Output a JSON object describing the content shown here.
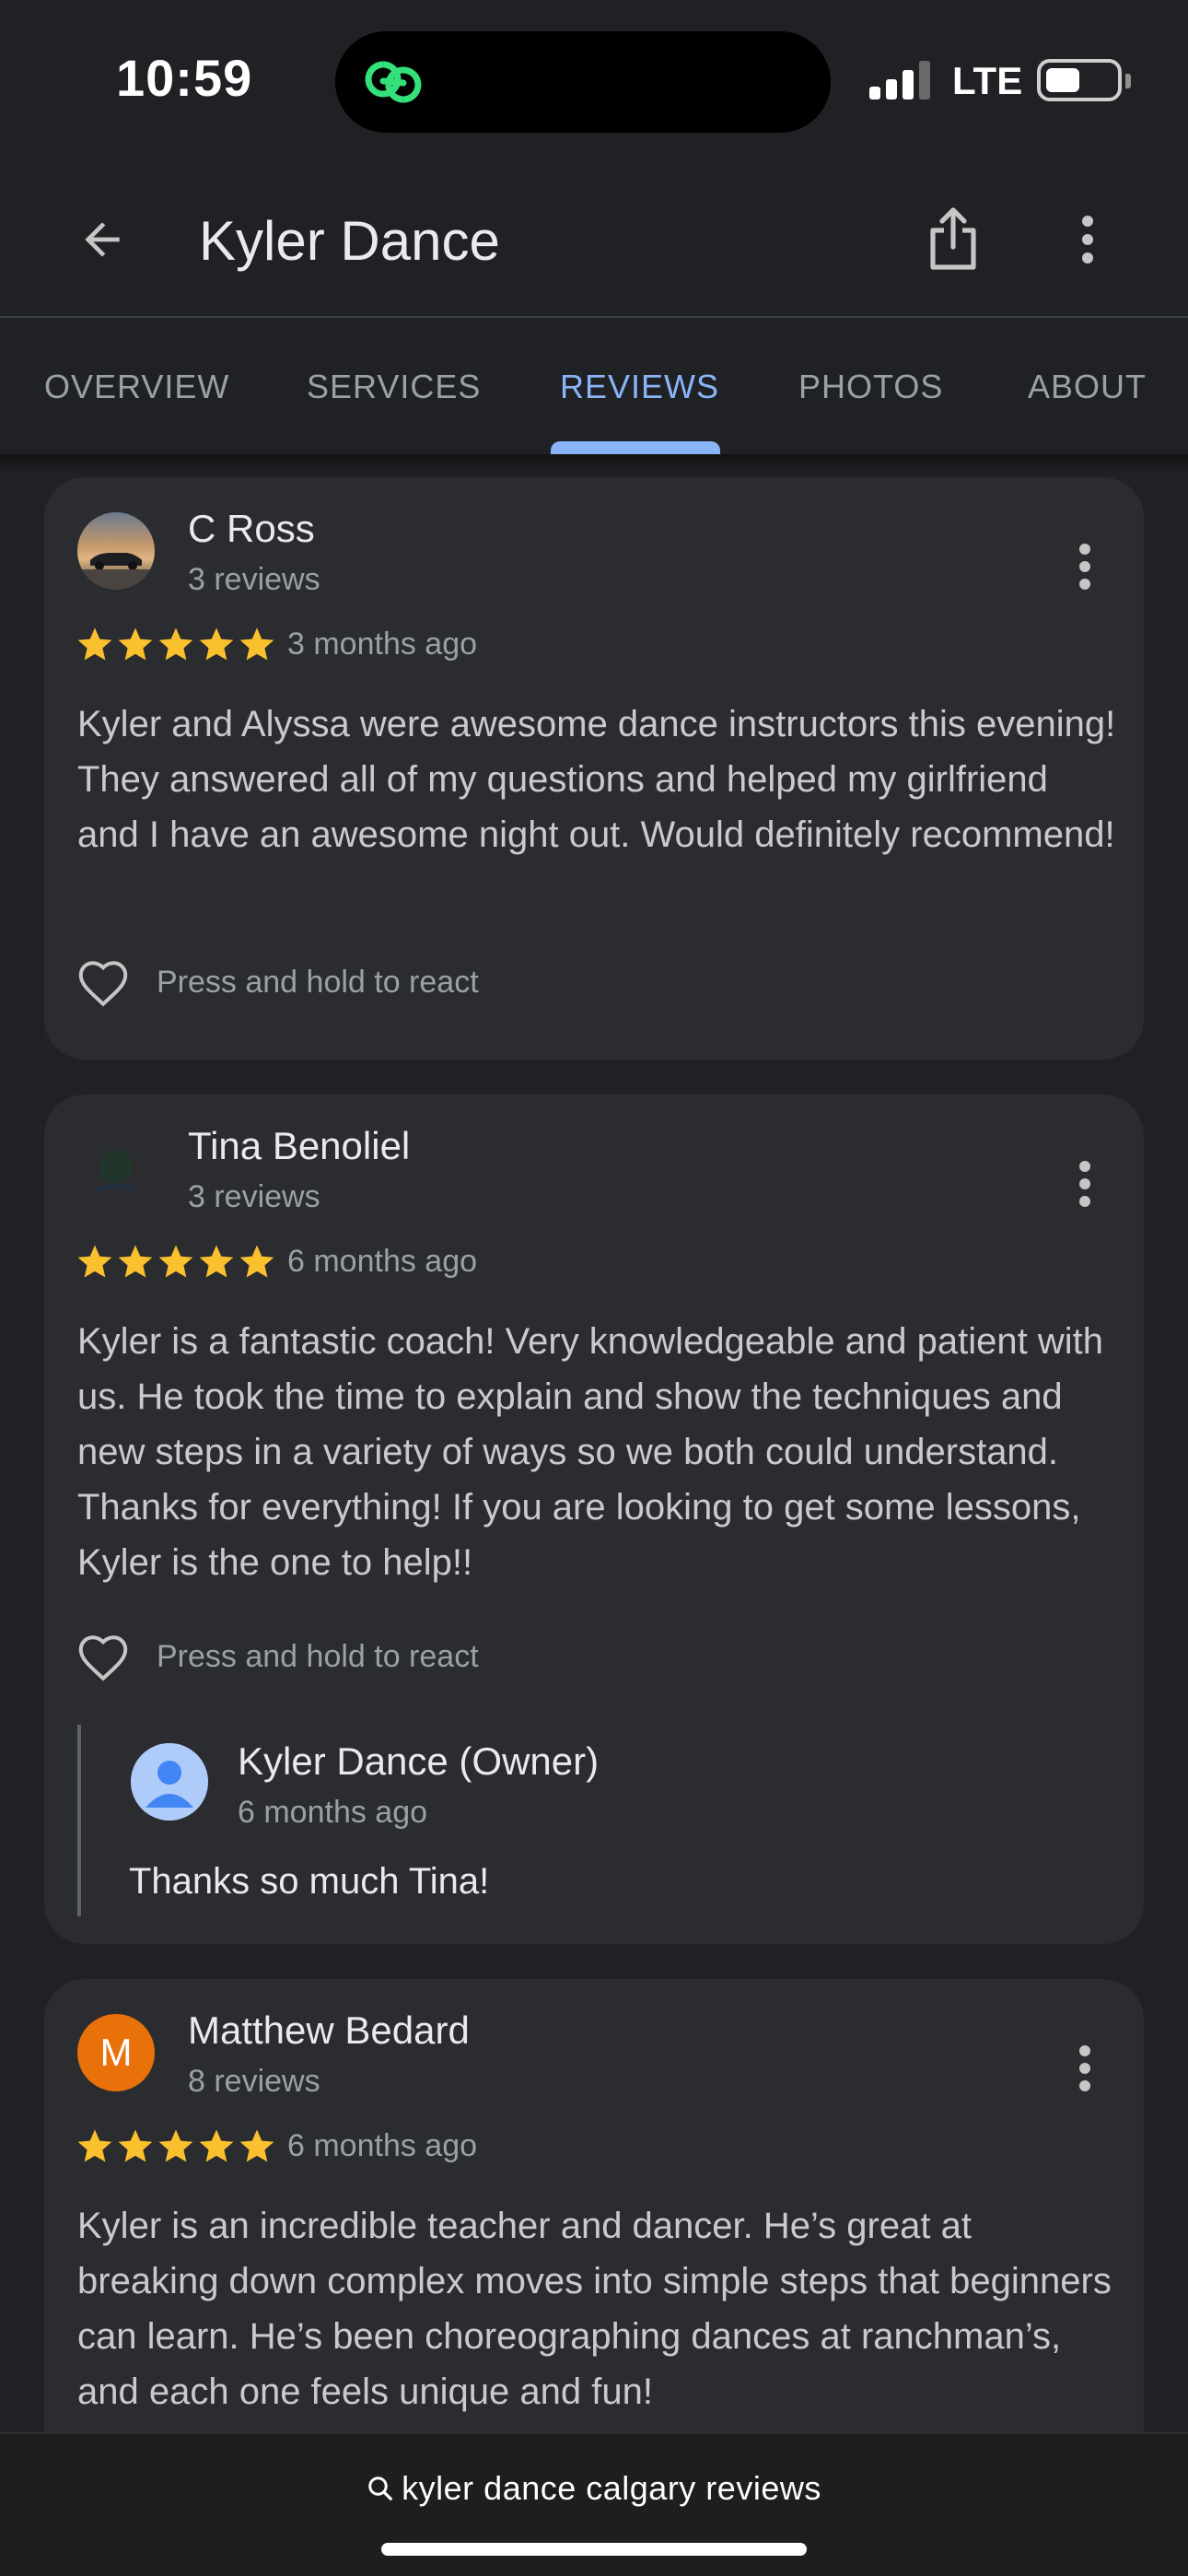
{
  "status_bar": {
    "time": "10:59",
    "network": "LTE",
    "island_icon": "link-app-icon",
    "island_icon_color": "#34e079"
  },
  "header": {
    "title": "Kyler Dance",
    "back_icon": "arrow-back-icon",
    "share_icon": "share-icon",
    "more_icon": "more-vert-icon"
  },
  "tabs": [
    {
      "label": "OVERVIEW",
      "active": false
    },
    {
      "label": "SERVICES",
      "active": false
    },
    {
      "label": "REVIEWS",
      "active": true
    },
    {
      "label": "PHOTOS",
      "active": false
    },
    {
      "label": "ABOUT",
      "active": false
    }
  ],
  "reviews": [
    {
      "author": "C Ross",
      "review_count": "3 reviews",
      "rating": 5,
      "date": "3 months ago",
      "text": "Kyler and Alyssa were awesome dance instructors this evening! They answered all of my questions and helped my girlfriend and I have an awesome night out. Would definitely recommend!",
      "react_label": "Press and hold to react"
    },
    {
      "author": "Tina Benoliel",
      "review_count": "3 reviews",
      "rating": 5,
      "date": "6 months ago",
      "text": "Kyler is a fantastic coach! Very knowledgeable and patient with us. He took the time to explain and show the techniques and new steps in a variety of ways so we both could understand. Thanks for everything! If you are looking to get some lessons, Kyler is the one to help!!",
      "react_label": "Press and hold to react",
      "owner_reply": {
        "name": "Kyler Dance (Owner)",
        "date": "6 months ago",
        "text": "Thanks so much Tina!"
      }
    },
    {
      "author": "Matthew Bedard",
      "avatar_letter": "M",
      "review_count": "8 reviews",
      "rating": 5,
      "date": "6 months ago",
      "text": "Kyler is an incredible teacher and dancer. He’s great at breaking down complex moves into simple steps that beginners can learn. He’s been choreographing dances at ranchman’s, and each one feels unique and fun!"
    }
  ],
  "bottom_bar": {
    "search_query": "kyler dance calgary reviews",
    "search_icon": "search-icon"
  },
  "colors": {
    "background": "#202124",
    "card": "#2b2c2f",
    "accent": "#8ab4f8",
    "star": "#fbc02d",
    "avatar_orange": "#e8710a"
  }
}
